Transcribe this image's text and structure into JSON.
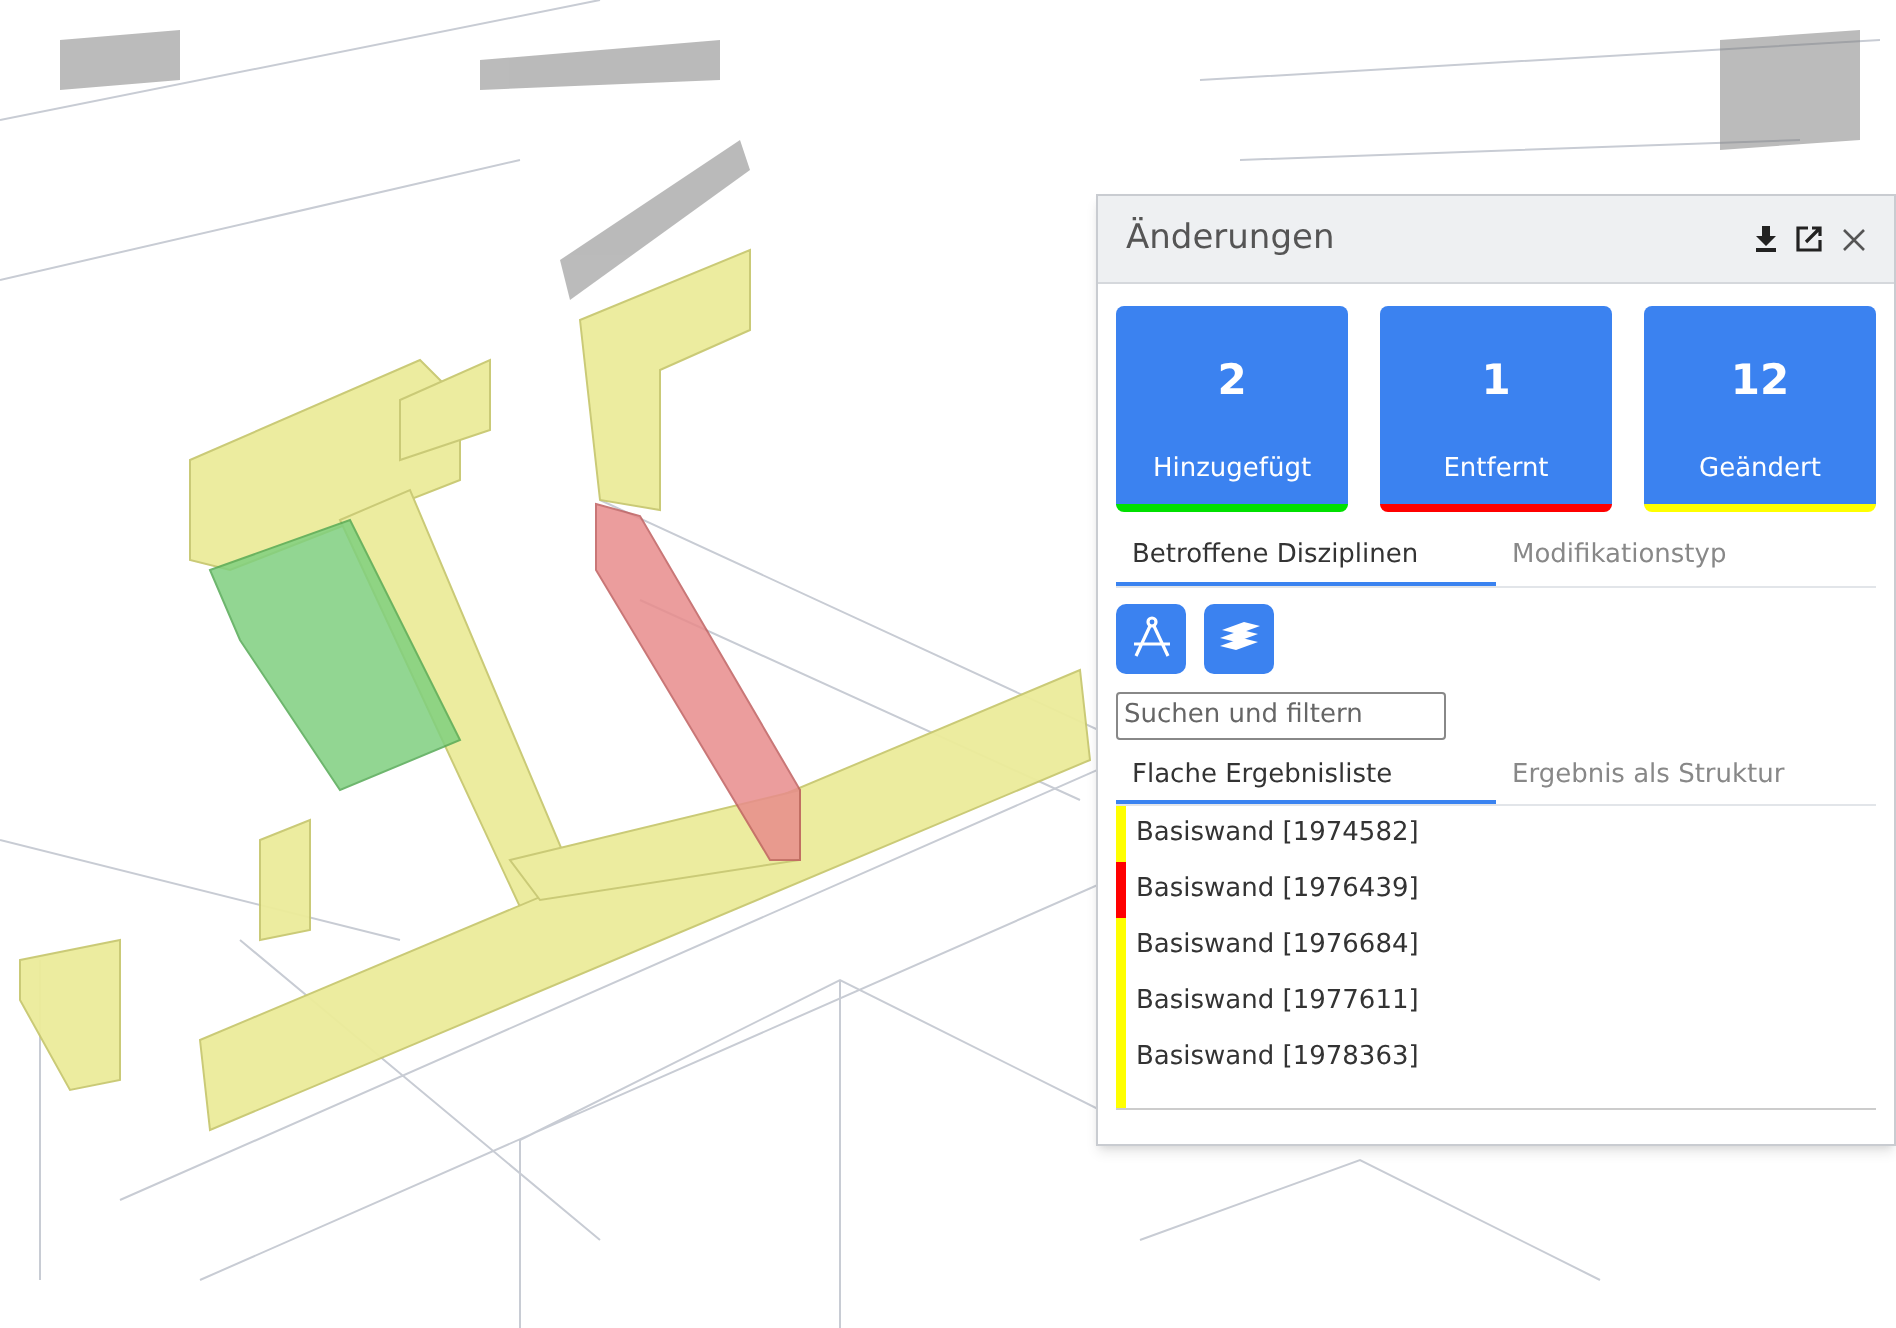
{
  "panel": {
    "title": "Änderungen",
    "summary_cards": [
      {
        "count": "2",
        "label": "Hinzugefügt",
        "color": "#00e000"
      },
      {
        "count": "1",
        "label": "Entfernt",
        "color": "#ff0000"
      },
      {
        "count": "12",
        "label": "Geändert",
        "color": "#ffff00"
      }
    ],
    "tabs": [
      {
        "label": "Betroffene Disziplinen",
        "selected": true
      },
      {
        "label": "Modifikationstyp",
        "selected": false
      }
    ],
    "discipline_buttons": [
      {
        "kind": "compass"
      },
      {
        "kind": "layers"
      }
    ],
    "search": {
      "placeholder": "Suchen und filtern"
    },
    "result_tabs": [
      {
        "label": "Flache Ergebnisliste",
        "selected": true
      },
      {
        "label": "Ergebnis als Struktur",
        "selected": false
      }
    ],
    "results": [
      {
        "label": "Basiswand [1974582]",
        "color": "#ffff00"
      },
      {
        "label": "Basiswand [1976439]",
        "color": "#ff0000"
      },
      {
        "label": "Basiswand [1976684]",
        "color": "#ffff00"
      },
      {
        "label": "Basiswand [1977611]",
        "color": "#ffff00"
      },
      {
        "label": "Basiswand [1978363]",
        "color": "#ffff00"
      },
      {
        "color": "#ffff00"
      }
    ]
  }
}
